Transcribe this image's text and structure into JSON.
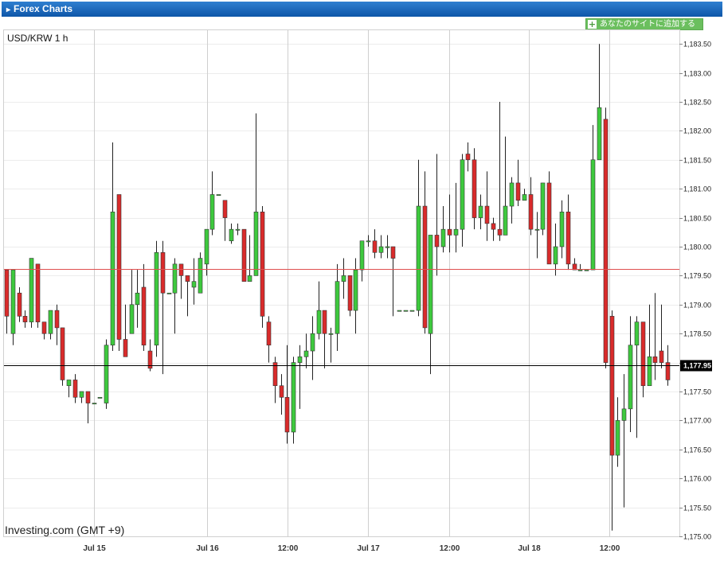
{
  "header": {
    "title": "Forex Charts",
    "add_button": "あなたのサイトに追加する"
  },
  "chart_data": {
    "type": "candlestick",
    "title": "USD/KRW 1 h",
    "watermark": "Investing.com (GMT +9)",
    "ylim": [
      1175.0,
      1183.75
    ],
    "y_ticks": [
      "1,175.00",
      "1,175.50",
      "1,176.00",
      "1,176.50",
      "1,177.00",
      "1,177.50",
      "1,178.00",
      "1,178.50",
      "1,179.00",
      "1,179.50",
      "1,180.00",
      "1,180.50",
      "1,181.00",
      "1,181.50",
      "1,182.00",
      "1,182.50",
      "1,183.00",
      "1,183.50"
    ],
    "x_labels": [
      "Jul 15",
      "Jul 16",
      "12:00",
      "Jul 17",
      "12:00",
      "Jul 18",
      "12:00"
    ],
    "current_price": 1177.95,
    "current_price_label": "1,177.95",
    "reference_line": 1179.62,
    "colors": {
      "up": "#3ec93e",
      "down": "#d92b2b",
      "ref_line": "#e05050",
      "price_line": "#000000"
    },
    "candles": [
      [
        1179.6,
        1179.6,
        1178.8,
        1178.5
      ],
      [
        1178.5,
        1179.5,
        1179.6,
        1178.3
      ],
      [
        1179.2,
        1179.3,
        1178.8,
        1178.7
      ],
      [
        1178.8,
        1178.9,
        1178.7,
        1178.6
      ],
      [
        1178.7,
        1179.7,
        1179.8,
        1178.6
      ],
      [
        1179.7,
        1179.7,
        1178.7,
        1178.6
      ],
      [
        1178.7,
        1178.7,
        1178.5,
        1178.4
      ],
      [
        1178.5,
        1178.5,
        1178.9,
        1178.4
      ],
      [
        1178.9,
        1179.0,
        1178.6,
        1178.3
      ],
      [
        1178.6,
        1178.6,
        1177.7,
        1177.6
      ],
      [
        1177.6,
        1177.6,
        1177.7,
        1177.4
      ],
      [
        1177.7,
        1177.8,
        1177.4,
        1177.3
      ],
      [
        1177.4,
        1177.4,
        1177.5,
        1177.3
      ],
      [
        1177.5,
        1177.5,
        1177.3,
        1176.95
      ],
      [
        1177.3,
        1177.3,
        1177.3,
        1177.3
      ],
      [
        1177.4,
        1177.4,
        1177.4,
        1177.4
      ],
      [
        1177.3,
        1178.4,
        1178.3,
        1177.2
      ],
      [
        1178.3,
        1181.8,
        1180.6,
        1178.2
      ],
      [
        1180.9,
        1180.9,
        1178.4,
        1178.2
      ],
      [
        1178.4,
        1179.0,
        1178.1,
        1178.1
      ],
      [
        1178.5,
        1179.6,
        1179.0,
        1178.5
      ],
      [
        1179.0,
        1179.6,
        1179.2,
        1178.6
      ],
      [
        1179.3,
        1179.7,
        1178.3,
        1178.2
      ],
      [
        1178.2,
        1178.4,
        1177.9,
        1177.85
      ],
      [
        1178.3,
        1180.1,
        1179.9,
        1178.1
      ],
      [
        1179.9,
        1180.1,
        1179.2,
        1177.8
      ],
      [
        1179.2,
        1179.2,
        1179.2,
        1179.2
      ],
      [
        1179.2,
        1179.8,
        1179.7,
        1178.5
      ],
      [
        1179.7,
        1179.7,
        1179.5,
        1179.1
      ],
      [
        1179.5,
        1179.5,
        1179.4,
        1178.8
      ],
      [
        1179.3,
        1179.8,
        1179.4,
        1179.0
      ],
      [
        1179.2,
        1179.9,
        1179.8,
        1179.2
      ],
      [
        1179.7,
        1180.3,
        1180.3,
        1179.5
      ],
      [
        1180.3,
        1181.3,
        1180.9,
        1180.2
      ],
      [
        1180.9,
        1180.9,
        1180.9,
        1180.9
      ],
      [
        1180.8,
        1180.8,
        1180.5,
        1180.1
      ],
      [
        1180.1,
        1180.4,
        1180.3,
        1180.05
      ],
      [
        1180.3,
        1180.4,
        1180.3,
        1180.2
      ],
      [
        1180.3,
        1180.3,
        1179.4,
        1179.4
      ],
      [
        1179.4,
        1180.2,
        1179.5,
        1179.4
      ],
      [
        1179.5,
        1182.3,
        1180.6,
        1179.5
      ],
      [
        1180.6,
        1180.7,
        1178.8,
        1178.6
      ],
      [
        1178.7,
        1178.8,
        1178.3,
        1178.0
      ],
      [
        1178.0,
        1178.1,
        1177.6,
        1177.3
      ],
      [
        1177.6,
        1177.8,
        1177.4,
        1177.1
      ],
      [
        1177.4,
        1178.3,
        1176.8,
        1176.6
      ],
      [
        1176.8,
        1178.1,
        1178.0,
        1176.6
      ],
      [
        1178.0,
        1178.3,
        1178.1,
        1177.2
      ],
      [
        1178.1,
        1178.5,
        1178.2,
        1177.9
      ],
      [
        1178.2,
        1178.8,
        1178.5,
        1177.7
      ],
      [
        1178.5,
        1179.4,
        1178.9,
        1178.4
      ],
      [
        1178.9,
        1178.9,
        1178.5,
        1177.9
      ],
      [
        1178.5,
        1178.6,
        1178.5,
        1178.0
      ],
      [
        1178.5,
        1179.7,
        1179.4,
        1178.2
      ],
      [
        1179.4,
        1179.8,
        1179.5,
        1179.1
      ],
      [
        1179.5,
        1179.5,
        1178.9,
        1178.8
      ],
      [
        1178.9,
        1179.8,
        1179.6,
        1178.5
      ],
      [
        1179.6,
        1179.7,
        1180.1,
        1179.4
      ],
      [
        1180.1,
        1180.2,
        1180.1,
        1180.0
      ],
      [
        1180.1,
        1180.3,
        1179.9,
        1179.8
      ],
      [
        1179.9,
        1180.2,
        1180.0,
        1179.8
      ],
      [
        1180.0,
        1180.2,
        1180.0,
        1179.8
      ],
      [
        1180.0,
        1180.0,
        1179.8,
        1178.8
      ],
      [
        1178.9,
        1178.9,
        1178.9,
        1178.9
      ],
      [
        1178.9,
        1178.9,
        1178.9,
        1178.9
      ],
      [
        1178.9,
        1178.9,
        1178.9,
        1178.9
      ],
      [
        1178.9,
        1181.5,
        1180.7,
        1178.8
      ],
      [
        1180.7,
        1181.3,
        1178.6,
        1178.5
      ],
      [
        1178.5,
        1178.6,
        1180.2,
        1177.8
      ],
      [
        1180.2,
        1181.6,
        1180.0,
        1179.5
      ],
      [
        1180.0,
        1180.7,
        1180.3,
        1179.9
      ],
      [
        1180.3,
        1180.9,
        1180.2,
        1179.9
      ],
      [
        1180.2,
        1181.1,
        1180.3,
        1179.9
      ],
      [
        1180.3,
        1181.6,
        1181.5,
        1180.0
      ],
      [
        1181.6,
        1181.8,
        1181.5,
        1181.3
      ],
      [
        1181.5,
        1181.7,
        1180.5,
        1180.3
      ],
      [
        1180.5,
        1180.9,
        1180.7,
        1180.3
      ],
      [
        1180.7,
        1181.3,
        1180.4,
        1180.1
      ],
      [
        1180.4,
        1180.5,
        1180.3,
        1180.1
      ],
      [
        1180.3,
        1182.5,
        1180.2,
        1180.1
      ],
      [
        1180.2,
        1181.9,
        1180.7,
        1180.2
      ],
      [
        1180.7,
        1181.2,
        1181.1,
        1180.4
      ],
      [
        1181.1,
        1181.5,
        1180.8,
        1180.7
      ],
      [
        1180.8,
        1181.0,
        1180.9,
        1180.8
      ],
      [
        1180.9,
        1181.2,
        1180.3,
        1180.2
      ],
      [
        1180.3,
        1180.6,
        1180.3,
        1179.8
      ],
      [
        1180.3,
        1181.1,
        1181.1,
        1180.2
      ],
      [
        1181.1,
        1181.3,
        1179.7,
        1179.7
      ],
      [
        1179.7,
        1180.4,
        1180.0,
        1179.5
      ],
      [
        1180.0,
        1180.8,
        1180.6,
        1179.8
      ],
      [
        1180.6,
        1180.9,
        1179.7,
        1179.6
      ],
      [
        1179.7,
        1179.8,
        1179.6,
        1179.6
      ],
      [
        1179.6,
        1179.7,
        1179.6,
        1179.6
      ],
      [
        1179.6,
        1179.6,
        1179.6,
        1179.6
      ],
      [
        1179.6,
        1182.1,
        1181.5,
        1179.6
      ],
      [
        1181.5,
        1183.5,
        1182.4,
        1181.5
      ],
      [
        1182.2,
        1182.4,
        1178.0,
        1177.9
      ],
      [
        1178.8,
        1178.9,
        1176.4,
        1175.1
      ],
      [
        1176.4,
        1177.4,
        1177.0,
        1176.2
      ],
      [
        1177.0,
        1177.8,
        1177.2,
        1175.5
      ],
      [
        1177.2,
        1178.8,
        1178.3,
        1176.8
      ],
      [
        1178.3,
        1178.8,
        1178.7,
        1176.7
      ],
      [
        1178.7,
        1178.4,
        1177.6,
        1177.4
      ],
      [
        1177.6,
        1179.0,
        1178.1,
        1177.6
      ],
      [
        1178.1,
        1179.2,
        1178.0,
        1177.7
      ],
      [
        1178.2,
        1179.0,
        1178.0,
        1177.9
      ],
      [
        1178.0,
        1178.3,
        1177.7,
        1177.6
      ]
    ]
  }
}
